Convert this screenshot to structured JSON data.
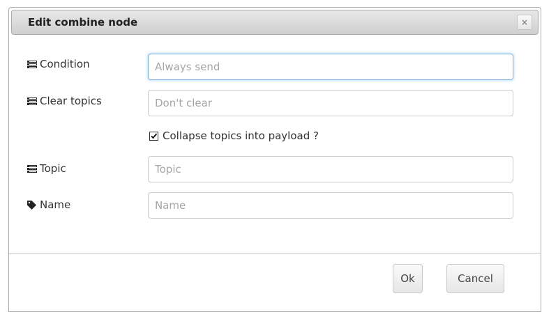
{
  "dialog": {
    "title": "Edit combine node",
    "close_glyph": "×"
  },
  "form": {
    "condition": {
      "label": "Condition",
      "icon": "list-icon",
      "value": "",
      "placeholder": "Always send"
    },
    "clear_topics": {
      "label": "Clear topics",
      "icon": "list-icon",
      "value": "",
      "placeholder": "Don't clear"
    },
    "collapse": {
      "label": "Collapse topics into payload ?",
      "checked": true
    },
    "topic": {
      "label": "Topic",
      "icon": "list-icon",
      "value": "",
      "placeholder": "Topic"
    },
    "name": {
      "label": "Name",
      "icon": "tag-icon",
      "value": "",
      "placeholder": "Name"
    }
  },
  "buttons": {
    "ok": "Ok",
    "cancel": "Cancel"
  },
  "colors": {
    "focus_border": "#7fb2e5",
    "titlebar": "#dcdcdc",
    "text": "#333333"
  }
}
